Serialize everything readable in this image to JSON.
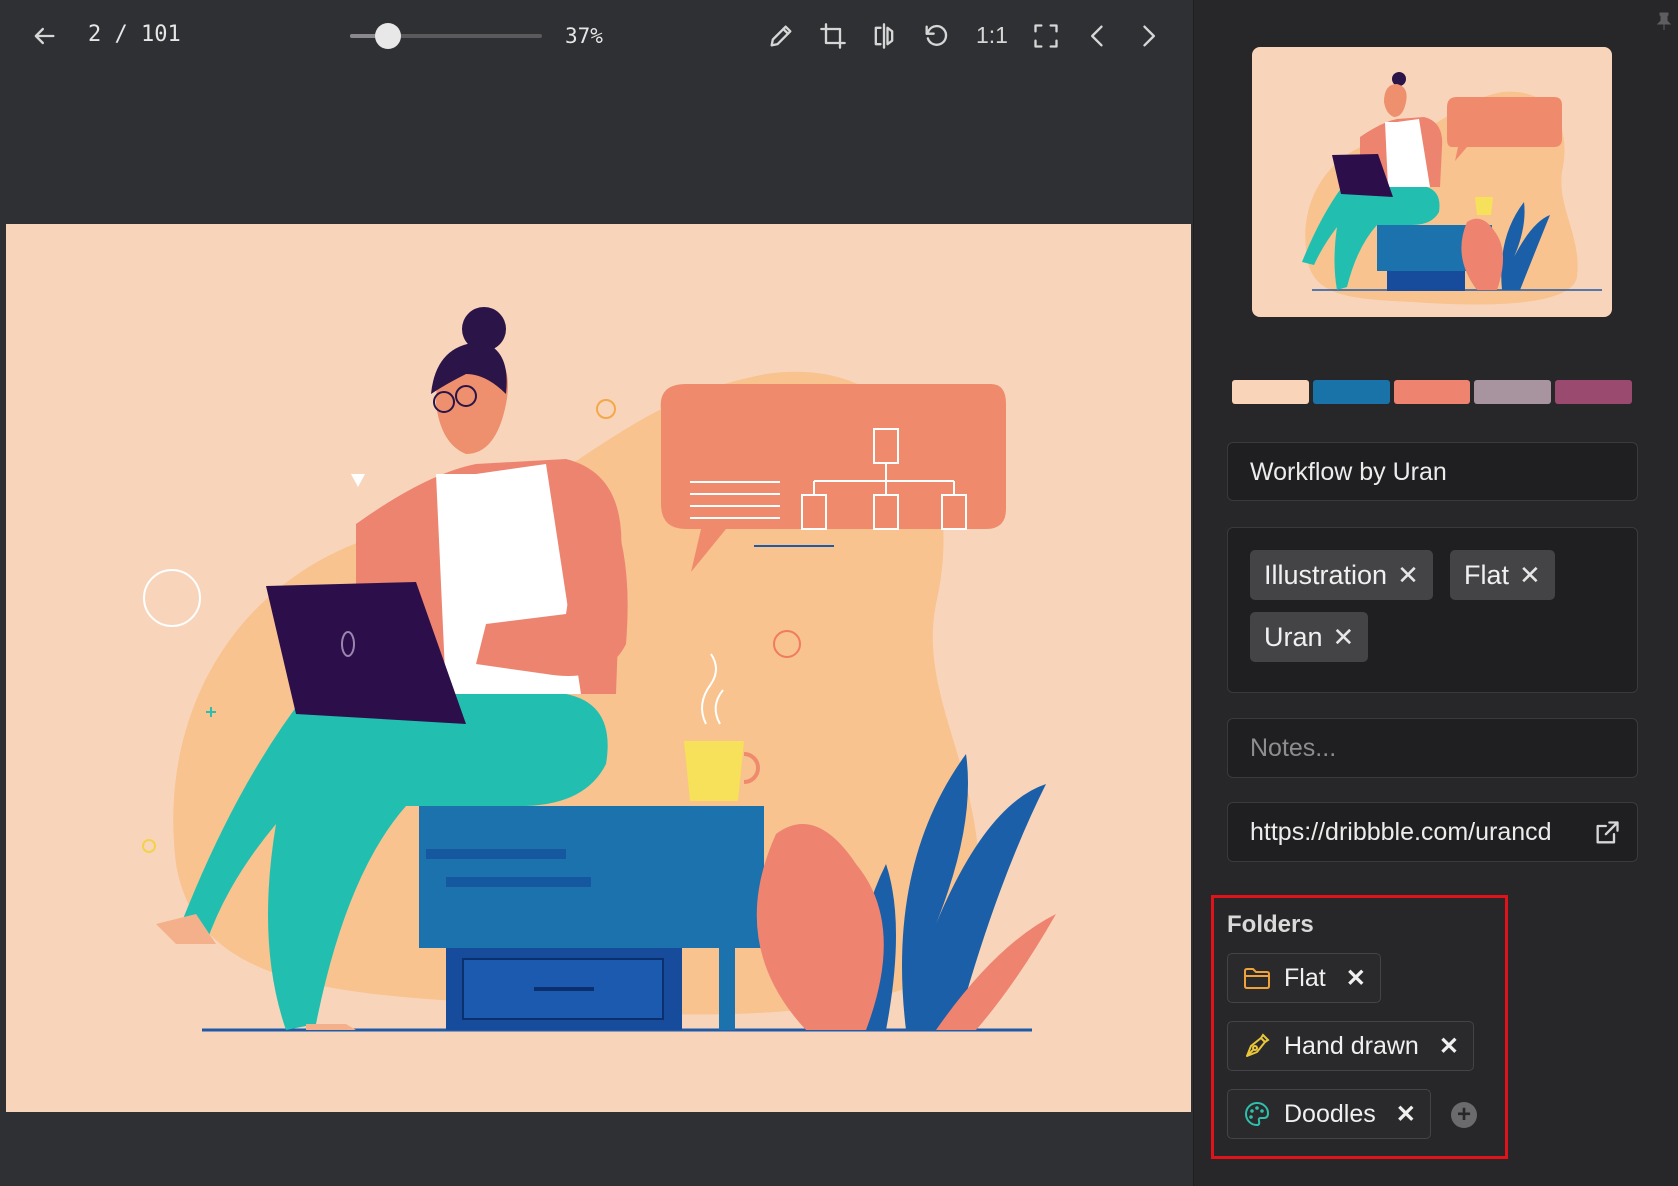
{
  "toolbar": {
    "counter": "2 / 101",
    "zoom_label": "37%",
    "zoom_value": 0.2,
    "one_to_one": "1:1",
    "icons": [
      "back-arrow-icon",
      "pencil-icon",
      "crop-icon",
      "flip-icon",
      "rotate-icon",
      "fullscreen-icon",
      "chevron-left-icon",
      "chevron-right-icon"
    ]
  },
  "palette": [
    "#f9d4b8",
    "#1a73a8",
    "#ee8370",
    "#a8949f",
    "#9a4a6e"
  ],
  "sidebar": {
    "title": "Workflow by Uran",
    "tags": [
      {
        "label": "Illustration"
      },
      {
        "label": "Flat"
      },
      {
        "label": "Uran"
      }
    ],
    "notes_placeholder": "Notes...",
    "url": "https://dribbble.com/urancd",
    "folders_title": "Folders",
    "folders": [
      {
        "label": "Flat",
        "icon": "folder-icon"
      },
      {
        "label": "Hand drawn",
        "icon": "pen-nib-icon"
      },
      {
        "label": "Doodles",
        "icon": "palette-icon"
      }
    ],
    "remove_glyph": "✕"
  }
}
